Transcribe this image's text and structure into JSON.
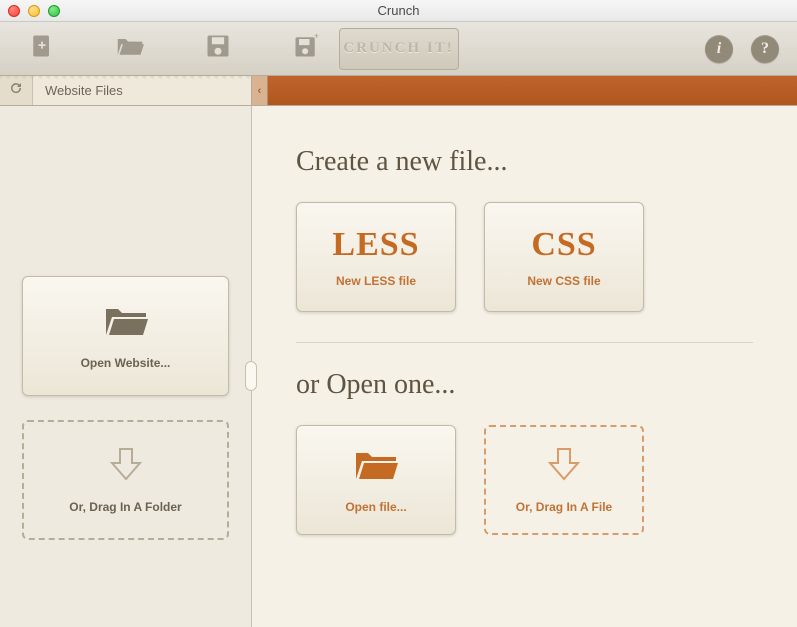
{
  "window": {
    "title": "Crunch"
  },
  "toolbar": {
    "crunch_label": "CRUNCH IT!",
    "info_label": "i",
    "help_label": "?"
  },
  "subheader": {
    "tab_label": "Website Files",
    "collapse_glyph": "‹"
  },
  "sidebar": {
    "open_website_label": "Open Website...",
    "drag_folder_label": "Or, Drag In A Folder"
  },
  "main": {
    "create_heading": "Create a new file...",
    "less_big": "LESS",
    "less_sub": "New LESS file",
    "css_big": "CSS",
    "css_sub": "New CSS file",
    "open_heading": "or Open one...",
    "open_file_label": "Open file...",
    "drag_file_label": "Or, Drag In A File"
  },
  "colors": {
    "accent": "#c56a23",
    "tan": "#efeadf"
  }
}
